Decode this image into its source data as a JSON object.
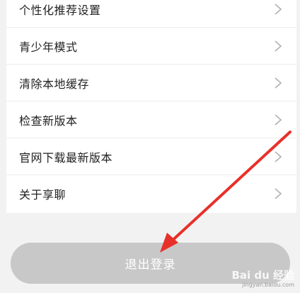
{
  "settings": {
    "items": [
      {
        "label": "个性化推荐设置",
        "icon": "chevron-right-icon"
      },
      {
        "label": "青少年模式",
        "icon": "chevron-right-icon"
      },
      {
        "label": "清除本地缓存",
        "icon": "chevron-right-icon"
      },
      {
        "label": "检查新版本",
        "icon": "chevron-right-icon"
      },
      {
        "label": "官网下载最新版本",
        "icon": "chevron-right-icon"
      },
      {
        "label": "关于享聊",
        "icon": "chevron-right-icon"
      }
    ]
  },
  "logout": {
    "label": "退出登录"
  },
  "annotation": {
    "color": "#e8302a",
    "icon": "red-arrow-icon"
  },
  "watermark": {
    "main": "Bai du 经验",
    "sub": "jingyan.baidu.com"
  },
  "colors": {
    "background": "#f2f2f2",
    "list_bg": "#ffffff",
    "button_bg": "#c8c8c8",
    "text": "#222222",
    "chevron": "#b0b0b0"
  }
}
